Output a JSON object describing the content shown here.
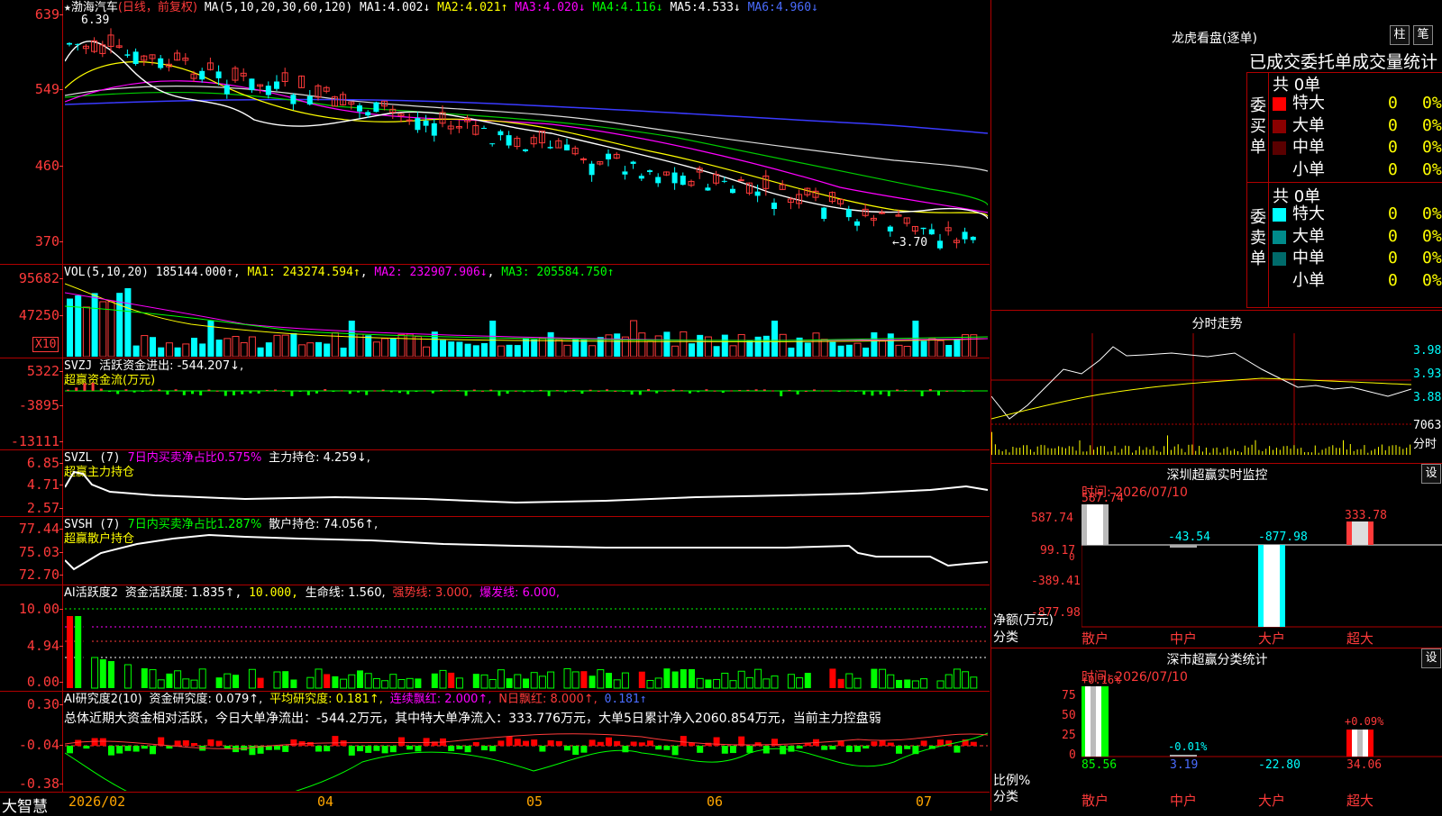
{
  "stock": {
    "star": "★",
    "name": "渤海汽车",
    "mode": "(日线，前复权)",
    "ma_params": "MA(5,10,20,30,60,120)",
    "ma": [
      {
        "k": "MA1:",
        "v": "4.002↓"
      },
      {
        "k": "MA2:",
        "v": "4.021↑"
      },
      {
        "k": "MA3:",
        "v": "4.020↓"
      },
      {
        "k": "MA4:",
        "v": "4.116↓"
      },
      {
        "k": "MA5:",
        "v": "4.533↓"
      },
      {
        "k": "MA6:",
        "v": "4.960↓"
      }
    ],
    "high_mark": "6.39",
    "low_mark": "←3.70",
    "axis": [
      "639",
      "549",
      "460",
      "370"
    ]
  },
  "vol": {
    "params": "VOL(5,10,20)",
    "value": "185144.000↑",
    "ma1": "MA1: 243274.594↑",
    "ma2": "MA2: 232907.906↓",
    "ma3": "MA3: 205584.750↑",
    "axis": [
      "95682",
      "47250"
    ],
    "unit": "X10"
  },
  "svzj": {
    "title": "SVZJ",
    "label": "活跃资金进出: -544.207↓,",
    "sub": "超赢资金流(万元)",
    "axis": [
      "5322",
      "-3895",
      "-13111"
    ]
  },
  "svzl": {
    "title": "SVZL (7)",
    "pct": "7日内买卖净占比0.575%",
    "main": "主力持仓: 4.259↓,",
    "sub": "超赢主力持仓",
    "axis": [
      "6.85",
      "4.71",
      "2.57"
    ]
  },
  "svsh": {
    "title": "SVSH (7)",
    "pct": "7日内买卖净占比1.287%",
    "main": "散户持仓: 74.056↑,",
    "sub": "超赢散户持仓",
    "axis": [
      "77.44",
      "75.03",
      "72.70"
    ]
  },
  "ai1": {
    "title": "AI活跃度2",
    "a": "资金活跃度: 1.835↑",
    "b": "10.000,",
    "c": "生命线: 1.560,",
    "d": "强势线: 3.000,",
    "e": "爆发线: 6.000,",
    "axis": [
      "10.00",
      "4.94",
      "0.00"
    ]
  },
  "ai2": {
    "title": "AI研究度2(10)",
    "a": "资金研究度: 0.079↑,",
    "b": "平均研究度: 0.181↑,",
    "c": "连续飘红: 2.000↑,",
    "d": "N日飘红: 8.000↑,",
    "e": "0.181↑",
    "summary": "总体近期大资金相对活跃，今日大单净流出：-544.2万元，其中特大单净流入：333.776万元，大单5日累计净入2060.854万元，当前主力控盘弱",
    "axis": [
      "0.30",
      "-0.04",
      "-0.38"
    ]
  },
  "bottom": {
    "brand": "大智慧",
    "dates": [
      "2026/02",
      "04",
      "05",
      "06",
      "07"
    ]
  },
  "dragon": {
    "title": "龙虎看盘(逐单)",
    "btn1": "柱",
    "btn2": "笔",
    "tabs": [
      "已成交",
      "委托单",
      "成交量统计"
    ],
    "buy": {
      "side": "委买单",
      "count": "共 0单",
      "rows": [
        {
          "label": "特大",
          "n": "0",
          "p": "0%",
          "color": "#ff0000"
        },
        {
          "label": "大单",
          "n": "0",
          "p": "0%",
          "color": "#8b0000"
        },
        {
          "label": "中单",
          "n": "0",
          "p": "0%",
          "color": "#5a0000"
        },
        {
          "label": "小单",
          "n": "0",
          "p": "0%",
          "color": "#000000"
        }
      ]
    },
    "sell": {
      "side": "委卖单",
      "count": "共 0单",
      "rows": [
        {
          "label": "特大",
          "n": "0",
          "p": "0%",
          "color": "#00ffff"
        },
        {
          "label": "大单",
          "n": "0",
          "p": "0%",
          "color": "#008b8b"
        },
        {
          "label": "中单",
          "n": "0",
          "p": "0%",
          "color": "#006b6b"
        },
        {
          "label": "小单",
          "n": "0",
          "p": "0%",
          "color": "#000000"
        }
      ]
    }
  },
  "intraday": {
    "title": "分时走势",
    "prices": [
      "3.980",
      "3.930",
      "3.880"
    ],
    "vol": "7063",
    "vol_unit": "分时"
  },
  "monitor": {
    "title": "深圳超赢实时监控",
    "btn": "设",
    "time": "时间: 2026/07/10",
    "axis": [
      "587.74",
      "99.17",
      "0",
      "-389.41",
      "-877.98"
    ],
    "ylabel": "净额(万元)",
    "xlabel": "分类",
    "cats": [
      "散户",
      "中户",
      "大户",
      "超大"
    ],
    "values": [
      "587.74",
      "-43.54",
      "-877.98",
      "333.78"
    ]
  },
  "classify": {
    "title": "深市超赢分类统计",
    "btn": "设",
    "time": "时间: 2026/07/10",
    "axis": [
      "75",
      "50",
      "25",
      "0"
    ],
    "ylabel": "比例%",
    "xlabel": "分类",
    "cats": [
      "散户",
      "中户",
      "大户",
      "超大"
    ],
    "tops": [
      "+0.16%",
      "-0.01%",
      "",
      "+0.09%"
    ],
    "values": [
      "85.56",
      "3.19",
      "-22.80",
      "34.06"
    ]
  }
}
